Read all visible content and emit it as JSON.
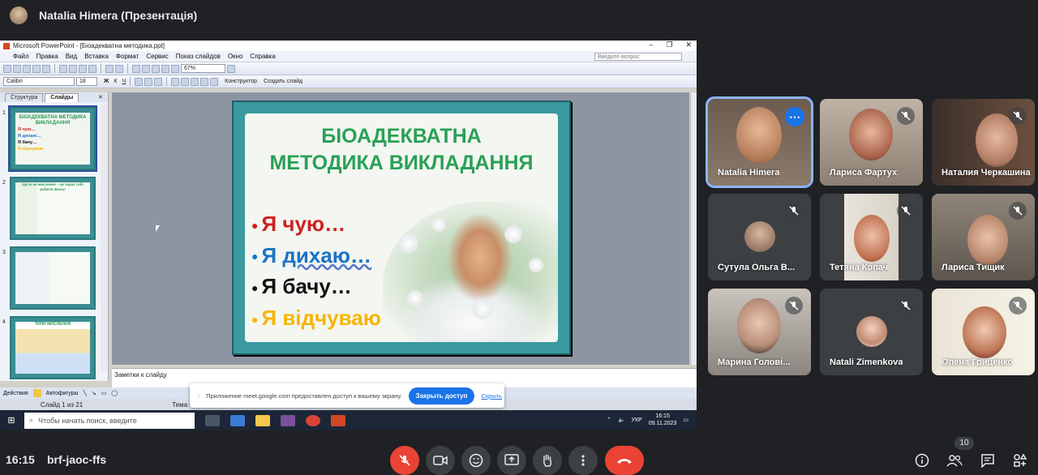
{
  "header": {
    "presenter_title": "Natalia Himera (Презентація)"
  },
  "ppt": {
    "window_title": "Microsoft PowerPoint - [Біоадекватна методика.ppt]",
    "menu": [
      "Файл",
      "Правка",
      "Вид",
      "Вставка",
      "Формат",
      "Сервис",
      "Показ слайдов",
      "Окно",
      "Справка"
    ],
    "ask_placeholder": "Введите вопрос",
    "zoom": "67%",
    "font_name": "Calibri",
    "font_size": "18",
    "design_label": "Конструктор",
    "new_slide_label": "Создать слайд",
    "tabs": [
      "Структура",
      "Слайды"
    ],
    "thumb_numbers": [
      "1",
      "2",
      "3",
      "4"
    ],
    "thumb1": {
      "title": "БІОАДЕКВАТНА МЕТОДИКА ВИКЛАДАННЯ",
      "items": [
        "Я чую…",
        "Я дихаю…",
        "Я бачу…",
        "Я відчуваю"
      ]
    },
    "thumb2_title": "Що ж не мислення – це зараз тобі робити якось!",
    "thumb4_title": "ТИПИ МИСЛЕННЯ",
    "slide": {
      "heading_line1": "БІОАДЕКВАТНА",
      "heading_line2": "МЕТОДИКА ВИКЛАДАННЯ",
      "bullets": [
        {
          "text": "Я чую…",
          "color": "#d0201f"
        },
        {
          "text": "Я ",
          "word": "дихаю…",
          "color": "#1b73c4"
        },
        {
          "text": "Я бачу…",
          "color": "#111111"
        },
        {
          "text": "Я відчуваю",
          "color": "#f7b500"
        }
      ]
    },
    "notes_placeholder": "Заметки к слайду",
    "actions_label": "Действия",
    "autoshapes_label": "Автофигуры",
    "status_slide": "Слайд 1 из 21",
    "status_theme": "Тема Office",
    "share_banner": {
      "text": "Приложение meet.google.com предоставлен доступ к вашему экрану.",
      "stop_label": "Закрыть доступ",
      "hide_label": "Скрыть"
    },
    "taskbar": {
      "search_placeholder": "Чтобы начать поиск, введите",
      "lang": "УКР",
      "time": "16:15",
      "date": "09.11.2023"
    }
  },
  "participants": [
    {
      "name": "Natalia Himera",
      "muted": false,
      "active": true
    },
    {
      "name": "Лариса Фартух",
      "muted": true
    },
    {
      "name": "Наталия Черкашина",
      "muted": true
    },
    {
      "name": "Сутула Ольга В...",
      "muted": true
    },
    {
      "name": "Тетяна Копач",
      "muted": true
    },
    {
      "name": "Лариса Тищик",
      "muted": true
    },
    {
      "name": "Марина Голові...",
      "muted": true
    },
    {
      "name": "Natali Zimenkova",
      "muted": true
    },
    {
      "name": "Олена Гриценко",
      "muted": true
    }
  ],
  "bottom": {
    "time": "16:15",
    "meeting_code": "brf-jaoc-ffs",
    "participant_count": "10"
  },
  "colors": {
    "end_call": "#ea4335",
    "mic_off": "#ea4335",
    "active_border": "#8ab4f8",
    "share_blue": "#1a73e8"
  }
}
